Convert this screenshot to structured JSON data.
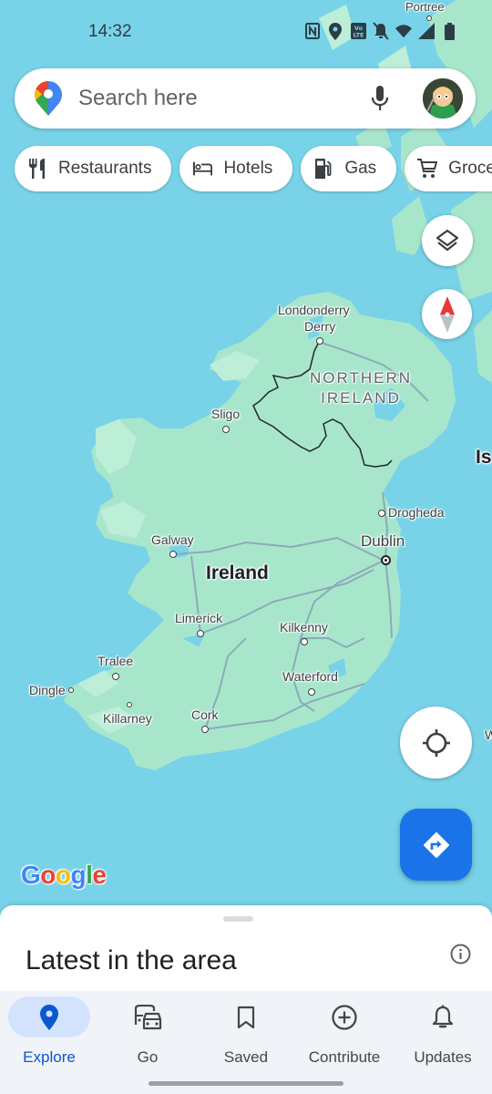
{
  "status_bar": {
    "time": "14:32",
    "icons": [
      "nfc-icon",
      "location-icon",
      "volte-icon",
      "mute-icon",
      "wifi-icon",
      "signal-icon",
      "battery-icon"
    ]
  },
  "search": {
    "placeholder": "Search here",
    "value": "",
    "mic_icon": "mic-icon",
    "avatar_icon": "account-avatar"
  },
  "chips": [
    {
      "label": "Restaurants",
      "icon": "restaurant-icon"
    },
    {
      "label": "Hotels",
      "icon": "hotel-icon"
    },
    {
      "label": "Gas",
      "icon": "gas-station-icon"
    },
    {
      "label": "Groceries",
      "icon": "cart-icon"
    }
  ],
  "map": {
    "labels": {
      "portree": "Portree",
      "londonderry": "Londonderry",
      "derry": "Derry",
      "northern_ireland_1": "NORTHERN",
      "northern_ireland_2": "IRELAND",
      "sligo": "Sligo",
      "isle": "Is",
      "drogheda": "Drogheda",
      "galway": "Galway",
      "dublin": "Dublin",
      "ireland": "Ireland",
      "limerick": "Limerick",
      "kilkenny": "Kilkenny",
      "tralee": "Tralee",
      "dingle": "Dingle",
      "waterford": "Waterford",
      "killarney": "Killarney",
      "cork": "Cork",
      "w_edge": "W"
    },
    "colors": {
      "water": "#78d3e8",
      "land": "#a8e6cc",
      "land_light": "#bdeed8",
      "road": "#8aa4b8",
      "border": "#1f2a22"
    }
  },
  "map_controls": {
    "layers": "layers-icon",
    "compass": "compass-icon",
    "my_location": "my-location-icon",
    "directions": "directions-icon"
  },
  "branding": {
    "google": [
      "G",
      "o",
      "o",
      "g",
      "l",
      "e"
    ]
  },
  "bottom_sheet": {
    "title": "Latest in the area",
    "info_icon": "info-icon"
  },
  "nav": {
    "active": "Explore",
    "items": [
      {
        "label": "Explore",
        "icon": "explore-pin-icon"
      },
      {
        "label": "Go",
        "icon": "commute-icon"
      },
      {
        "label": "Saved",
        "icon": "bookmark-icon"
      },
      {
        "label": "Contribute",
        "icon": "add-circle-icon"
      },
      {
        "label": "Updates",
        "icon": "bell-icon"
      }
    ]
  },
  "colors": {
    "accent": "#1a73e8",
    "nav_active": "#0b57d0",
    "nav_active_bg": "#d3e3fd",
    "nav_bg": "#f0f3f8"
  }
}
